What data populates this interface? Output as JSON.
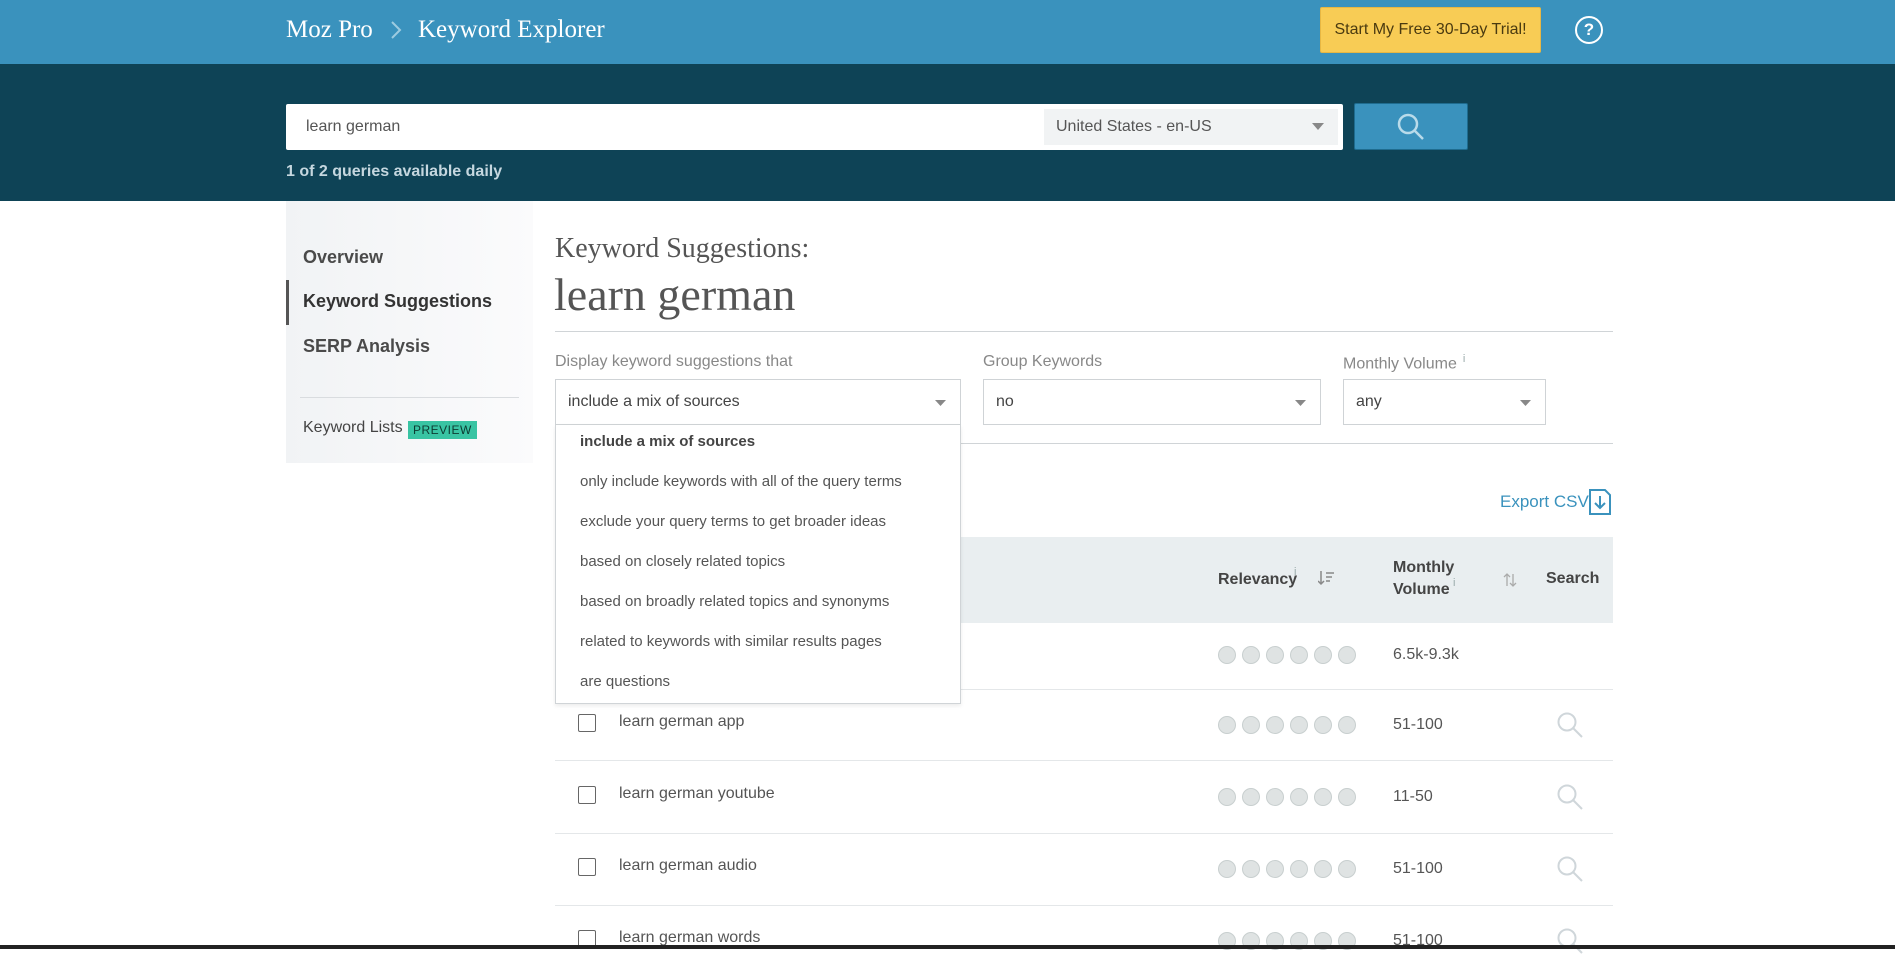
{
  "header": {
    "brand": "Moz Pro",
    "crumb": "Keyword Explorer",
    "trial_button": "Start My Free 30-Day Trial!",
    "help": "?"
  },
  "search": {
    "query": "learn german",
    "locale": "United States - en-US",
    "queries_available": "1 of 2 queries available daily"
  },
  "sidebar": {
    "items": [
      {
        "label": "Overview"
      },
      {
        "label": "Keyword Suggestions"
      },
      {
        "label": "SERP Analysis"
      }
    ],
    "keyword_lists": "Keyword Lists",
    "preview_badge": "PREVIEW"
  },
  "main": {
    "subtitle": "Keyword Suggestions:",
    "title": "learn german",
    "filters": {
      "display_label": "Display keyword suggestions that",
      "display_value": "include a mix of sources",
      "group_label": "Group Keywords",
      "group_value": "no",
      "volume_label": "Monthly Volume",
      "volume_value": "any",
      "info_icon": "i"
    },
    "dropdown_options": [
      "include a mix of sources",
      "only include keywords with all of the query terms",
      "exclude your query terms to get broader ideas",
      "based on closely related topics",
      "based on broadly related topics and synonyms",
      "related to keywords with similar results pages",
      "are questions"
    ],
    "export": "Export CSV",
    "table": {
      "headers": {
        "relevancy": "Relevancy",
        "monthly_volume_line1": "Monthly",
        "monthly_volume_line2": "Volume",
        "search": "Search"
      },
      "rows": [
        {
          "keyword": "",
          "volume": "6.5k-9.3k"
        },
        {
          "keyword": "learn german app",
          "volume": "51-100"
        },
        {
          "keyword": "learn german youtube",
          "volume": "11-50"
        },
        {
          "keyword": "learn german audio",
          "volume": "51-100"
        },
        {
          "keyword": "learn german words",
          "volume": "51-100"
        }
      ]
    }
  },
  "colors": {
    "header_blue": "#3a92bd",
    "search_band": "#0e4356",
    "trial_yellow": "#f8cc55",
    "preview_green": "#39c4a3",
    "link_blue": "#3a92bd"
  }
}
